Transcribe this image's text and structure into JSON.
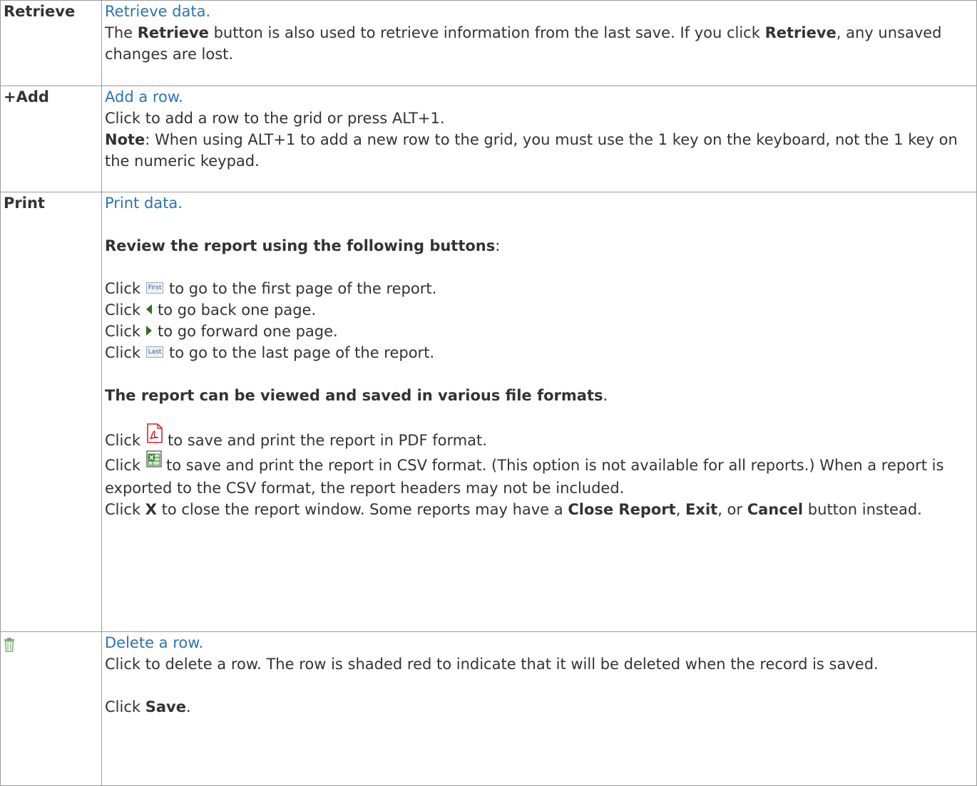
{
  "rows": [
    {
      "key": "Retrieve",
      "title": "Retrieve data.",
      "text1": "The ",
      "bold1": "Retrieve",
      "text2": " button is also used to retrieve information from the last save. If you click ",
      "bold2": "Retrieve",
      "text3": ", any unsaved changes are lost."
    },
    {
      "key": "+Add",
      "title": "Add a row.",
      "line1": "Click to add a row to the grid or press ALT+1.",
      "note_label": "Note",
      "note_text": ": When using ALT+1 to add a new row to the grid, you must use the 1 key on the keyboard, not the 1 key on the numeric keypad."
    },
    {
      "key": "Print",
      "title": "Print data.",
      "review_heading": "Review the report using the following buttons",
      "review_colon": ":",
      "click": "Click",
      "first_label": "First",
      "first_text": "to go to the first page of the report.",
      "prev_text": "to go back one page.",
      "next_text": "to go forward one page.",
      "last_label": "Last",
      "last_text": "to go to the last page of the report.",
      "formats_heading": "The report can be viewed and saved in various file formats",
      "formats_period": ".",
      "pdf_text": "to save and print the report in PDF format.",
      "csv_text": "to save and print the report in CSV format. (This option is not available for all reports.) When a report is exported to the CSV format, the report headers may not be included.",
      "close_pre": "Click ",
      "close_x": "X",
      "close_mid": " to close the report window. Some reports may have a ",
      "close_b1": "Close Report",
      "close_c1": ", ",
      "close_b2": "Exit",
      "close_c2": ", or ",
      "close_b3": "Cancel",
      "close_end": " button instead."
    },
    {
      "icon": "trash-icon",
      "title": "Delete a row.",
      "line1": "Click to delete a row. The row is shaded red to indicate that it will be deleted when the record is saved.",
      "save_pre": "Click ",
      "save_bold": "Save",
      "save_end": "."
    }
  ],
  "colors": {
    "link": "#2b73b7",
    "text": "#333333",
    "border": "#9a9a9a",
    "trash_icon": "#6fae6a",
    "pdf_red": "#d6262a",
    "excel_green": "#3b8a3a"
  }
}
